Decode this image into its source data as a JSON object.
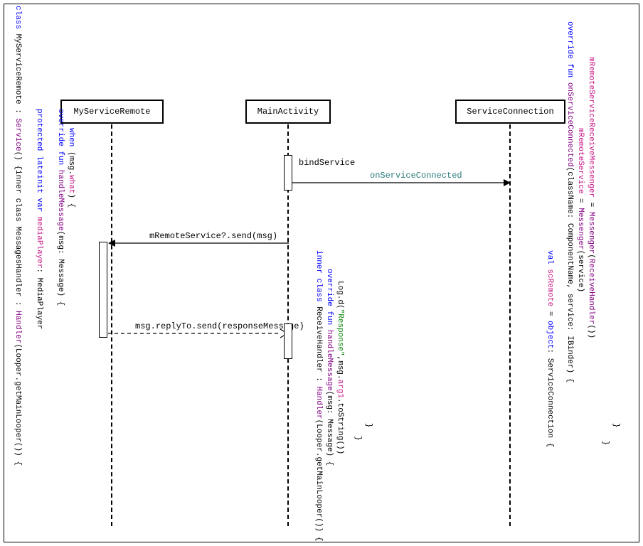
{
  "participants": {
    "p1": "MyServiceRemote",
    "p2": "MainActivity",
    "p3": "ServiceConnection"
  },
  "messages": {
    "m1": "bindService",
    "m2": "onServiceConnected",
    "m3_pre": "mRemoteService",
    "m3_post": "?.send(msg)",
    "m4_pre": "msg.",
    "m4_mid": "replyTo",
    "m4_post": ".send(responseMessage)"
  },
  "code_left": {
    "line1_kw": "class",
    "line1_cls": " MyServiceRemote : ",
    "line1_fn": "Service",
    "line1_rest": "() {inner class MessagesHandler : ",
    "line1_fn2": "Handler",
    "line1_rest2": "(Looper.getMainLooper()) {",
    "line2_kw": "protected lateinit var",
    "line2_prop": " mediaPlayer",
    "line2_rest": ": MediaPlayer",
    "line3_kw": "override fun",
    "line3_fn": " handleMessage",
    "line3_rest": "(msg: Message) {",
    "line4_kw": "when",
    "line4_rest": " (msg.",
    "line4_prop": "what",
    "line4_rest2": ") {"
  },
  "code_mid": {
    "line1_kw": "inner class",
    "line1_cls": " ReceiveHandler : ",
    "line1_fn": "Handler",
    "line1_rest": "(Looper.getMainLooper()) {",
    "line2_kw": "override fun",
    "line2_fn": " handleMessage",
    "line2_rest": "(msg: Message) {",
    "line3_pre": "Log.d(",
    "line3_str": "\"Response\"",
    "line3_mid": ",msg.",
    "line3_prop": "arg1",
    "line3_post": ".toString())",
    "close1": "  }",
    "close2": "}"
  },
  "code_right": {
    "line1_kw": "val",
    "line1_prop": " scRemote",
    "line1_rest": " = ",
    "line1_kw2": "object",
    "line1_rest2": ": ServiceConnection {",
    "line2_kw": "override fun",
    "line2_fn": " onServiceConnected",
    "line2_rest": "(className: ComponentName, service: IBinder) {",
    "line3_prop": "mRemoteService",
    "line3_rest": " = ",
    "line3_fn": "Messenger",
    "line3_rest2": "(service)",
    "line4_prop": "mRemoteServiceReceiveMessenger",
    "line4_rest": " = ",
    "line4_fn": "Messenger",
    "line4_rest2": "(",
    "line4_fn2": "ReceiveHandler",
    "line4_rest3": "())",
    "close1": "   }",
    "close2": "}"
  }
}
